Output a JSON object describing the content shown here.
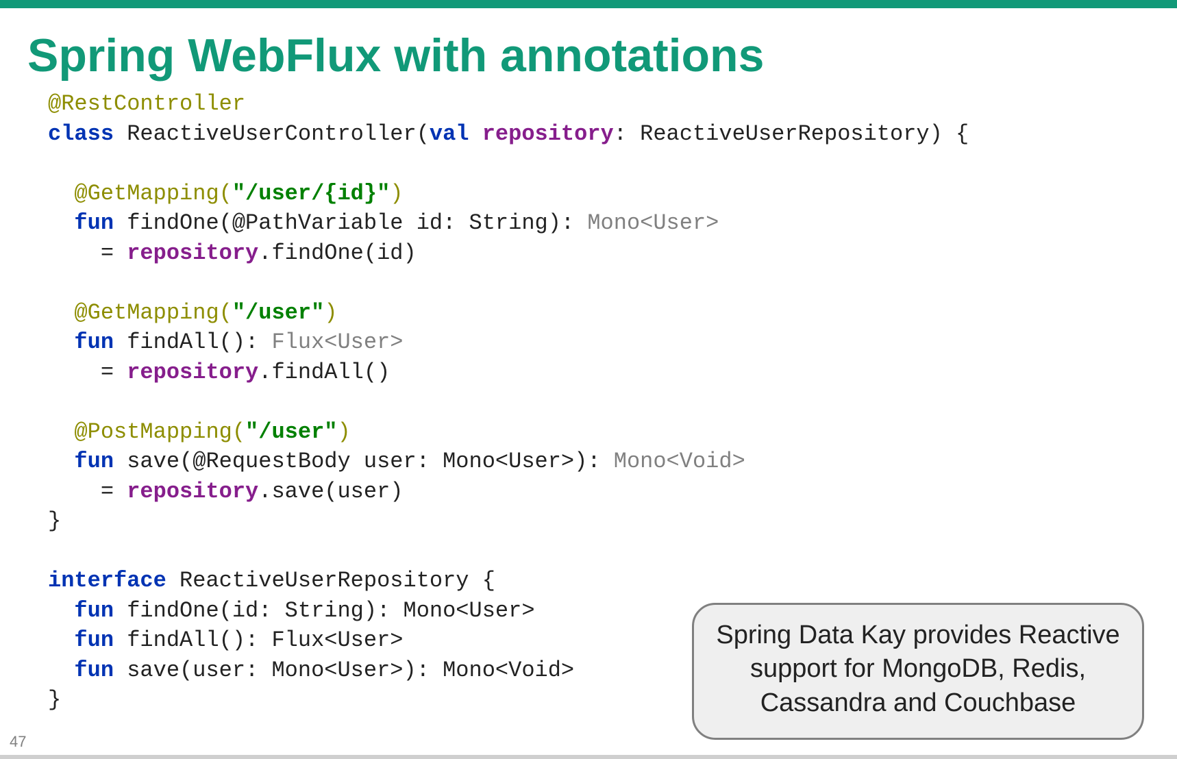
{
  "slide": {
    "title": "Spring WebFlux with annotations",
    "number": "47"
  },
  "note": {
    "text": "Spring Data Kay provides Reactive support for MongoDB, Redis, Cassandra and Couchbase"
  },
  "code": {
    "l01_ann": "@RestController",
    "l02_kw_class": "class",
    "l02_name1": " ReactiveUserController(",
    "l02_kw_val": "val",
    "l02_sp": " ",
    "l02_prop": "repository",
    "l02_rest": ": ReactiveUserRepository) {",
    "l04_ann": "  @GetMapping(",
    "l04_str": "\"/user/{id}\"",
    "l04_close": ")",
    "l05_ind": "  ",
    "l05_kw": "fun",
    "l05_txt": " findOne(@PathVariable id: String): ",
    "l05_grey": "Mono<User>",
    "l06_ind": "    = ",
    "l06_prop": "repository",
    "l06_rest": ".findOne(id)",
    "l08_ann": "  @GetMapping(",
    "l08_str": "\"/user\"",
    "l08_close": ")",
    "l09_ind": "  ",
    "l09_kw": "fun",
    "l09_txt": " findAll(): ",
    "l09_grey": "Flux<User>",
    "l10_ind": "    = ",
    "l10_prop": "repository",
    "l10_rest": ".findAll()",
    "l12_ann": "  @PostMapping(",
    "l12_str": "\"/user\"",
    "l12_close": ")",
    "l13_ind": "  ",
    "l13_kw": "fun",
    "l13_txt": " save(@RequestBody user: Mono<User>): ",
    "l13_grey": "Mono<Void>",
    "l14_ind": "    = ",
    "l14_prop": "repository",
    "l14_rest": ".save(user)",
    "l15_close": "}",
    "l17_kw": "interface",
    "l17_rest": " ReactiveUserRepository {",
    "l18_ind": "  ",
    "l18_kw": "fun",
    "l18_rest": " findOne(id: String): Mono<User>",
    "l19_ind": "  ",
    "l19_kw": "fun",
    "l19_rest": " findAll(): Flux<User>",
    "l20_ind": "  ",
    "l20_kw": "fun",
    "l20_rest": " save(user: Mono<User>): Mono<Void>",
    "l21_close": "}"
  }
}
